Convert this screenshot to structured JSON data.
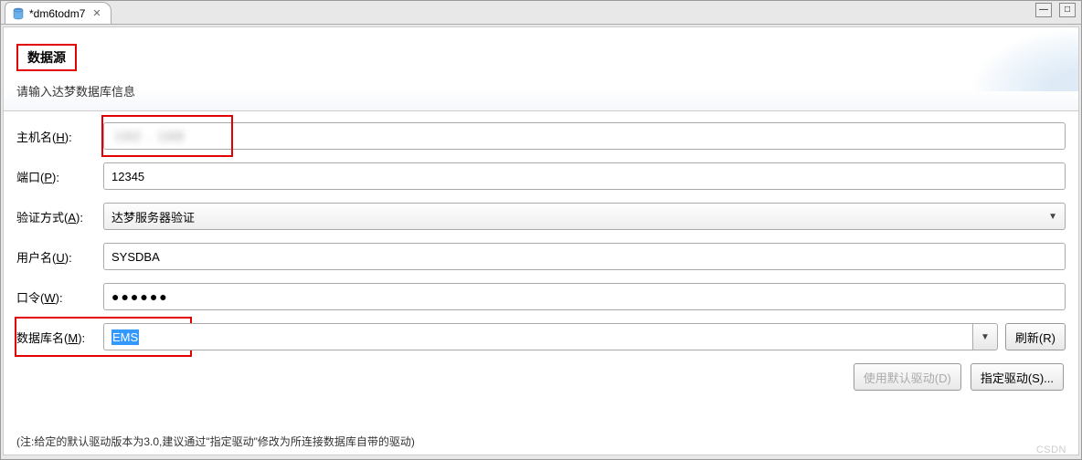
{
  "tab": {
    "title": "*dm6todm7",
    "close": "✕"
  },
  "winControls": {
    "minimize": "—",
    "maximize": "□"
  },
  "header": {
    "title": "数据源",
    "subtitle": "请输入达梦数据库信息"
  },
  "form": {
    "host": {
      "label": "主机名(",
      "mnemonic": "H",
      "labelEnd": "):",
      "value": ""
    },
    "port": {
      "label": "端口(",
      "mnemonic": "P",
      "labelEnd": "):",
      "value": "12345"
    },
    "auth": {
      "label": "验证方式(",
      "mnemonic": "A",
      "labelEnd": "):",
      "value": "达梦服务器验证"
    },
    "user": {
      "label": "用户名(",
      "mnemonic": "U",
      "labelEnd": "):",
      "value": "SYSDBA"
    },
    "password": {
      "label": "口令(",
      "mnemonic": "W",
      "labelEnd": "):",
      "value": "●●●●●●"
    },
    "dbname": {
      "label": "数据库名(",
      "mnemonic": "M",
      "labelEnd": "):",
      "value": "EMS"
    },
    "refresh": {
      "label": "刷新(",
      "mnemonic": "R",
      "labelEnd": ")"
    }
  },
  "driverButtons": {
    "useDefault": "使用默认驱动(D)",
    "specify": {
      "label": "指定驱动(",
      "mnemonic": "S",
      "labelEnd": ")..."
    }
  },
  "note": "(注:给定的默认驱动版本为3.0,建议通过\"指定驱动\"修改为所连接数据库自带的驱动)",
  "watermark": "CSDN"
}
